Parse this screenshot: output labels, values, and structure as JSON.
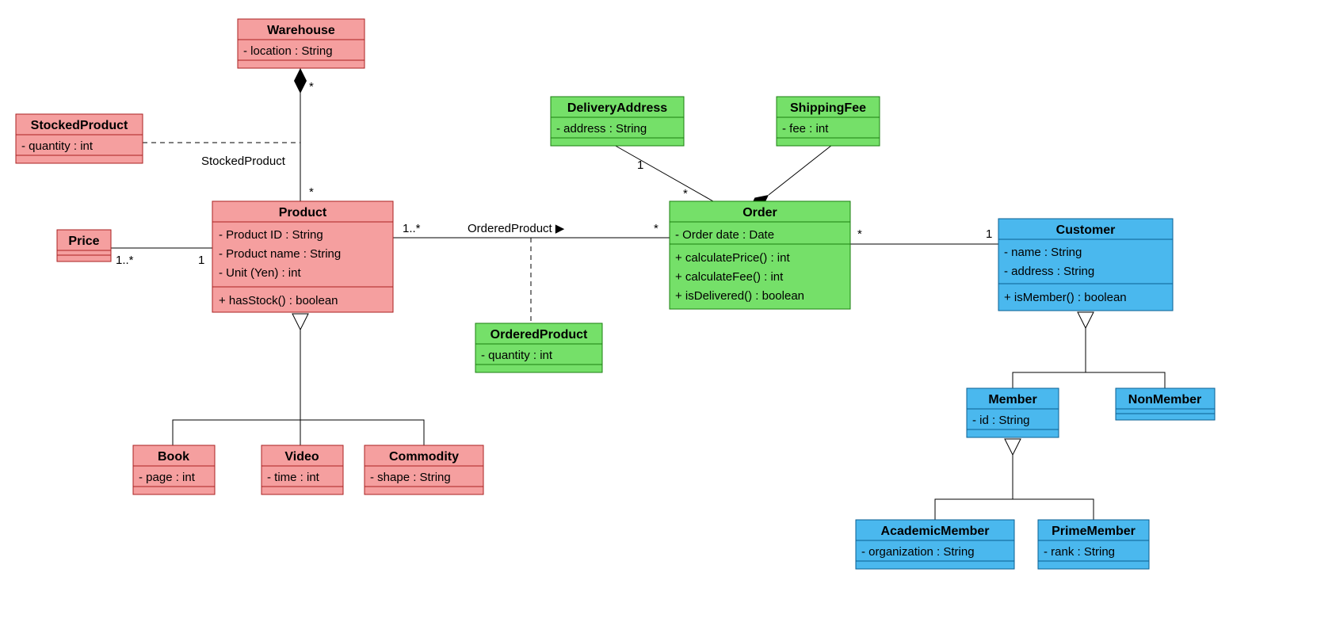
{
  "colors": {
    "pink": "#f59f9f",
    "pinkStroke": "#aa2020",
    "green": "#75e069",
    "greenStroke": "#1b7f10",
    "blue": "#4ab8ee",
    "blueStroke": "#0a5f93",
    "line": "#000"
  },
  "classes": {
    "warehouse": {
      "name": "Warehouse",
      "attrs": [
        "- location : String"
      ],
      "ops": []
    },
    "stockedProduct": {
      "name": "StockedProduct",
      "attrs": [
        "- quantity : int"
      ],
      "ops": []
    },
    "product": {
      "name": "Product",
      "attrs": [
        "- Product ID : String",
        "- Product name : String",
        "- Unit (Yen) : int"
      ],
      "ops": [
        "+ hasStock() : boolean"
      ]
    },
    "price": {
      "name": "Price",
      "attrs": [],
      "ops": []
    },
    "book": {
      "name": "Book",
      "attrs": [
        "- page : int"
      ],
      "ops": []
    },
    "video": {
      "name": "Video",
      "attrs": [
        "- time : int"
      ],
      "ops": []
    },
    "commodity": {
      "name": "Commodity",
      "attrs": [
        "- shape : String"
      ],
      "ops": []
    },
    "deliveryAddress": {
      "name": "DeliveryAddress",
      "attrs": [
        "- address : String"
      ],
      "ops": []
    },
    "shippingFee": {
      "name": "ShippingFee",
      "attrs": [
        "- fee : int"
      ],
      "ops": []
    },
    "order": {
      "name": "Order",
      "attrs": [
        "- Order date : Date"
      ],
      "ops": [
        "+ calculatePrice() : int",
        "+ calculateFee() : int",
        "+ isDelivered() : boolean"
      ]
    },
    "orderedProduct": {
      "name": "OrderedProduct",
      "attrs": [
        "- quantity : int"
      ],
      "ops": []
    },
    "customer": {
      "name": "Customer",
      "attrs": [
        "- name : String",
        "- address : String"
      ],
      "ops": [
        "+ isMember() : boolean"
      ]
    },
    "member": {
      "name": "Member",
      "attrs": [
        "- id : String"
      ],
      "ops": []
    },
    "nonMember": {
      "name": "NonMember",
      "attrs": [],
      "ops": []
    },
    "academicMember": {
      "name": "AcademicMember",
      "attrs": [
        "- organization : String"
      ],
      "ops": []
    },
    "primeMember": {
      "name": "PrimeMember",
      "attrs": [
        "- rank : String"
      ],
      "ops": []
    }
  },
  "labels": {
    "stockedProductAssoc": "StockedProduct",
    "orderedProductAssoc": "OrderedProduct",
    "star": "*",
    "one": "1",
    "oneStar": "1..*"
  }
}
